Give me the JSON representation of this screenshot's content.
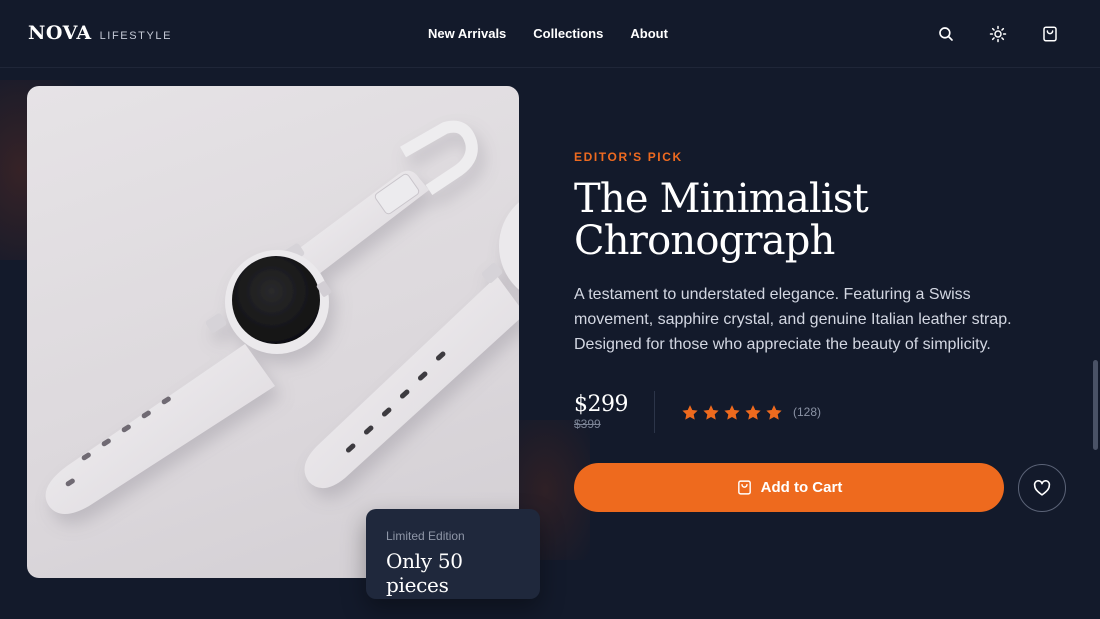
{
  "brand": {
    "logo": "NOVA",
    "sub": "LIFESTYLE"
  },
  "nav": [
    "New Arrivals",
    "Collections",
    "About"
  ],
  "header_icons": [
    "search-icon",
    "sun-icon",
    "shopping-bag-icon"
  ],
  "product": {
    "eyebrow": "EDITOR'S PICK",
    "title_line1": "The Minimalist",
    "title_line2": "Chronograph",
    "description": "A testament to understated elegance. Featuring a Swiss movement, sapphire crystal, and genuine Italian leather strap. Designed for those who appreciate the beauty of simplicity.",
    "price": "$299",
    "old_price": "$399",
    "rating": 5,
    "review_count": "(128)",
    "add_to_cart": "Add to Cart",
    "image_alt": "white smartwatch"
  },
  "badge": {
    "label": "Limited Edition",
    "value": "Only 50 pieces"
  },
  "colors": {
    "accent": "#ee6a1e",
    "background": "#131a2b",
    "card": "#1f283c"
  }
}
